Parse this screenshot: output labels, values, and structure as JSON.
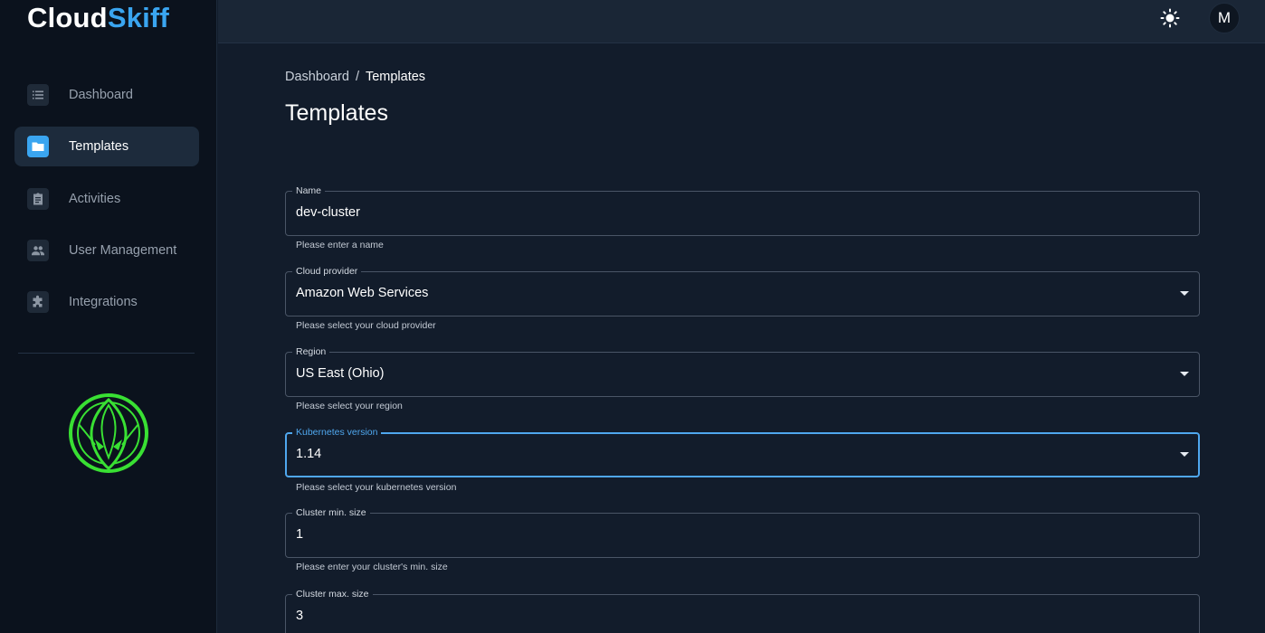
{
  "app": {
    "logo_part1": "Cloud",
    "logo_part2": "Skiff"
  },
  "sidebar": {
    "items": [
      {
        "label": "Dashboard",
        "icon": "list-icon",
        "active": false
      },
      {
        "label": "Templates",
        "icon": "folder-icon",
        "active": true
      },
      {
        "label": "Activities",
        "icon": "clipboard-icon",
        "active": false
      },
      {
        "label": "User Management",
        "icon": "people-icon",
        "active": false
      },
      {
        "label": "Integrations",
        "icon": "puzzle-icon",
        "active": false
      }
    ]
  },
  "topbar": {
    "theme_icon": "sun-icon",
    "avatar_initial": "M"
  },
  "breadcrumb": {
    "parent": "Dashboard",
    "separator": "/",
    "current": "Templates"
  },
  "page": {
    "title": "Templates"
  },
  "form": {
    "name": {
      "label": "Name",
      "value": "dev-cluster",
      "helper": "Please enter a name"
    },
    "cloud_provider": {
      "label": "Cloud provider",
      "value": "Amazon Web Services",
      "helper": "Please select your cloud provider"
    },
    "region": {
      "label": "Region",
      "value": "US East (Ohio)",
      "helper": "Please select your region"
    },
    "kubernetes_version": {
      "label": "Kubernetes version",
      "value": "1.14",
      "helper": "Please select your kubernetes version"
    },
    "cluster_min": {
      "label": "Cluster min. size",
      "value": "1",
      "helper": "Please enter your cluster's min. size"
    },
    "cluster_max": {
      "label": "Cluster max. size",
      "value": "3"
    }
  },
  "colors": {
    "accent": "#3aa5f0",
    "focus": "#4fa7ee",
    "brand_mark": "#39e033"
  }
}
